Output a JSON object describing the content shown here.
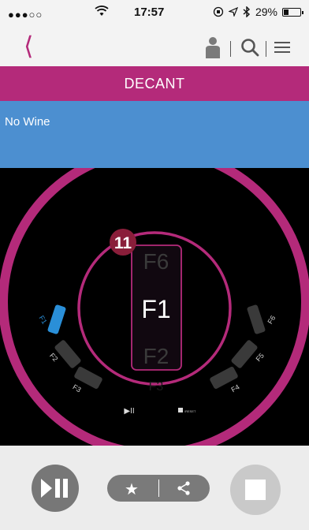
{
  "status_bar": {
    "signal": "●●●○○",
    "time": "17:57",
    "battery_percent": "29%",
    "battery_level": 0.29
  },
  "title": "DECANT",
  "wine_label": "No Wine",
  "dial": {
    "badge": "11",
    "selected": "F1",
    "above": "F6",
    "below": "F2",
    "faint_below": "F3",
    "left_filters": [
      {
        "label": "F1",
        "color": "#2a8fd8"
      },
      {
        "label": "F2",
        "color": "#3a3a3a"
      },
      {
        "label": "F3",
        "color": "#3a3a3a"
      }
    ],
    "right_filters": [
      {
        "label": "F6"
      },
      {
        "label": "F5"
      },
      {
        "label": "F4"
      }
    ],
    "play_pause_label": "▶II",
    "reset_label": "/RESET"
  },
  "colors": {
    "brand": "#b42a7a",
    "wine_panel": "#4c8fd0",
    "active_filter": "#2a8fd8"
  }
}
